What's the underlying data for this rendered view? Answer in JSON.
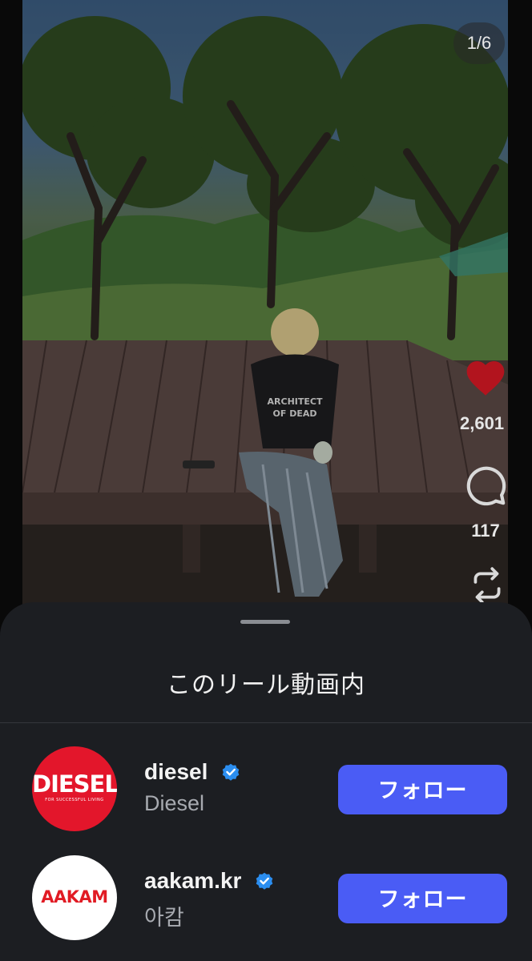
{
  "reel": {
    "photo_counter": "1/6",
    "like_count": "2,601",
    "comment_count": "117",
    "heart_color": "#b2141e",
    "shirt_print": "ARCHITECT OF DEAD"
  },
  "sheet": {
    "title": "このリール動画内",
    "accounts": [
      {
        "handle": "diesel",
        "display_name": "Diesel",
        "verified": true,
        "logo_text": "DIESEL",
        "logo_tagline": "FOR SUCCESSFUL LIVING",
        "follow_label": "フォロー"
      },
      {
        "handle": "aakam.kr",
        "display_name": "아캄",
        "verified": true,
        "logo_text": "AAKAM",
        "follow_label": "フォロー"
      }
    ]
  },
  "colors": {
    "sheet_bg": "#1c1e22",
    "follow_button": "#4a5cf5",
    "verified_badge": "#2b8ef0",
    "diesel_red": "#e3162b"
  }
}
